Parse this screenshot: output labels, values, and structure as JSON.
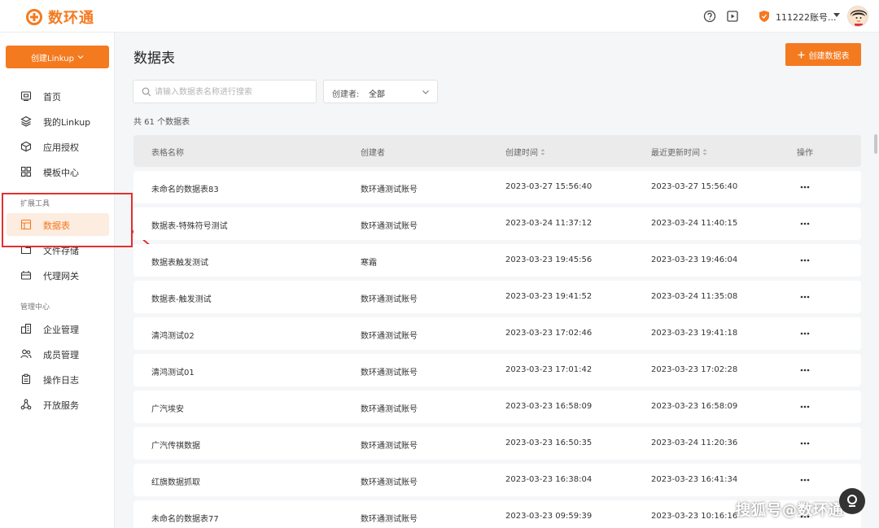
{
  "header": {
    "logo_text": "数环通",
    "org_name": "111222账号...",
    "brand_color": "#f47a20"
  },
  "sidebar": {
    "create_button": "创建Linkup",
    "items": [
      {
        "label": "首页",
        "icon": "monitor-icon"
      },
      {
        "label": "我的Linkup",
        "icon": "layers-icon"
      },
      {
        "label": "应用授权",
        "icon": "cube-icon"
      },
      {
        "label": "模板中心",
        "icon": "grid-icon"
      }
    ],
    "ext_title": "扩展工具",
    "ext_items": [
      {
        "label": "数据表",
        "icon": "table-icon",
        "active": true
      },
      {
        "label": "文件存储",
        "icon": "folder-icon"
      },
      {
        "label": "代理网关",
        "icon": "gateway-icon"
      }
    ],
    "mgmt_title": "管理中心",
    "mgmt_items": [
      {
        "label": "企业管理",
        "icon": "building-icon"
      },
      {
        "label": "成员管理",
        "icon": "users-icon"
      },
      {
        "label": "操作日志",
        "icon": "clipboard-icon"
      },
      {
        "label": "开放服务",
        "icon": "share-icon"
      }
    ]
  },
  "main": {
    "title": "数据表",
    "create_button": "创建数据表",
    "search_placeholder": "请输入数据表名称进行搜索",
    "creator_label": "创建者:",
    "creator_value": "全部",
    "count_text": "共 61 个数据表",
    "columns": [
      "表格名称",
      "创建者",
      "创建时间",
      "最近更新时间",
      "操作"
    ],
    "rows": [
      {
        "name": "未命名的数据表83",
        "creator": "数环通测试账号",
        "created": "2023-03-27 15:56:40",
        "updated": "2023-03-27 15:56:40"
      },
      {
        "name": "数据表-特殊符号测试",
        "creator": "数环通测试账号",
        "created": "2023-03-24 11:37:12",
        "updated": "2023-03-24 11:40:15"
      },
      {
        "name": "数据表触发测试",
        "creator": "寒霜",
        "created": "2023-03-23 19:45:56",
        "updated": "2023-03-23 19:46:04"
      },
      {
        "name": "数据表-触发测试",
        "creator": "数环通测试账号",
        "created": "2023-03-23 19:41:52",
        "updated": "2023-03-24 11:35:08"
      },
      {
        "name": "清鸿测试02",
        "creator": "数环通测试账号",
        "created": "2023-03-23 17:02:46",
        "updated": "2023-03-23 19:41:18"
      },
      {
        "name": "清鸿测试01",
        "creator": "数环通测试账号",
        "created": "2023-03-23 17:01:42",
        "updated": "2023-03-23 17:02:28"
      },
      {
        "name": "广汽埃安",
        "creator": "数环通测试账号",
        "created": "2023-03-23 16:58:09",
        "updated": "2023-03-23 16:58:09"
      },
      {
        "name": "广汽传祺数据",
        "creator": "数环通测试账号",
        "created": "2023-03-23 16:50:35",
        "updated": "2023-03-24 11:20:36"
      },
      {
        "name": "红旗数据抓取",
        "creator": "数环通测试账号",
        "created": "2023-03-23 16:38:04",
        "updated": "2023-03-23 16:41:34"
      },
      {
        "name": "未命名的数据表77",
        "creator": "数环通测试账号",
        "created": "2023-03-23 09:59:39",
        "updated": "2023-03-23 10:16:16"
      }
    ]
  },
  "watermark": "搜狐号@数环通"
}
